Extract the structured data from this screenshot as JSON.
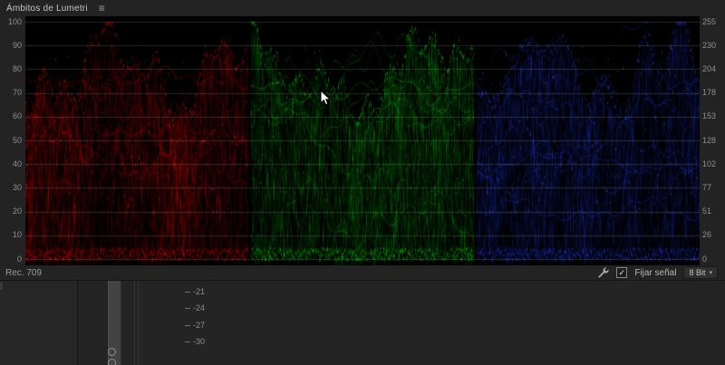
{
  "panel": {
    "title": "Ámbitos de Lumetri"
  },
  "icons": {
    "menu": "≡",
    "check": "✓",
    "dropdown": "▾"
  },
  "scope": {
    "bg": "#000000",
    "grid_color": "#272727",
    "left_scale": [
      "100",
      "90",
      "80",
      "70",
      "60",
      "50",
      "40",
      "30",
      "20",
      "10",
      "0"
    ],
    "right_scale": [
      "255",
      "230",
      "204",
      "178",
      "153",
      "128",
      "102",
      "77",
      "51",
      "26",
      "0"
    ],
    "type": "rgb-parade-waveform",
    "sections": [
      {
        "name": "red",
        "rgb": [
          255,
          0,
          0
        ],
        "seed": 11
      },
      {
        "name": "green",
        "rgb": [
          0,
          230,
          0
        ],
        "seed": 23
      },
      {
        "name": "blue",
        "rgb": [
          30,
          60,
          255
        ],
        "seed": 37
      }
    ]
  },
  "toolbar": {
    "colorspace": "Rec. 709",
    "clamp_label": "Fijar señal",
    "clamp_checked": true,
    "bit_depth": "8 Bit"
  },
  "lower_panel": {
    "db_labels": [
      "-21",
      "-24",
      "-27",
      "-30"
    ]
  }
}
